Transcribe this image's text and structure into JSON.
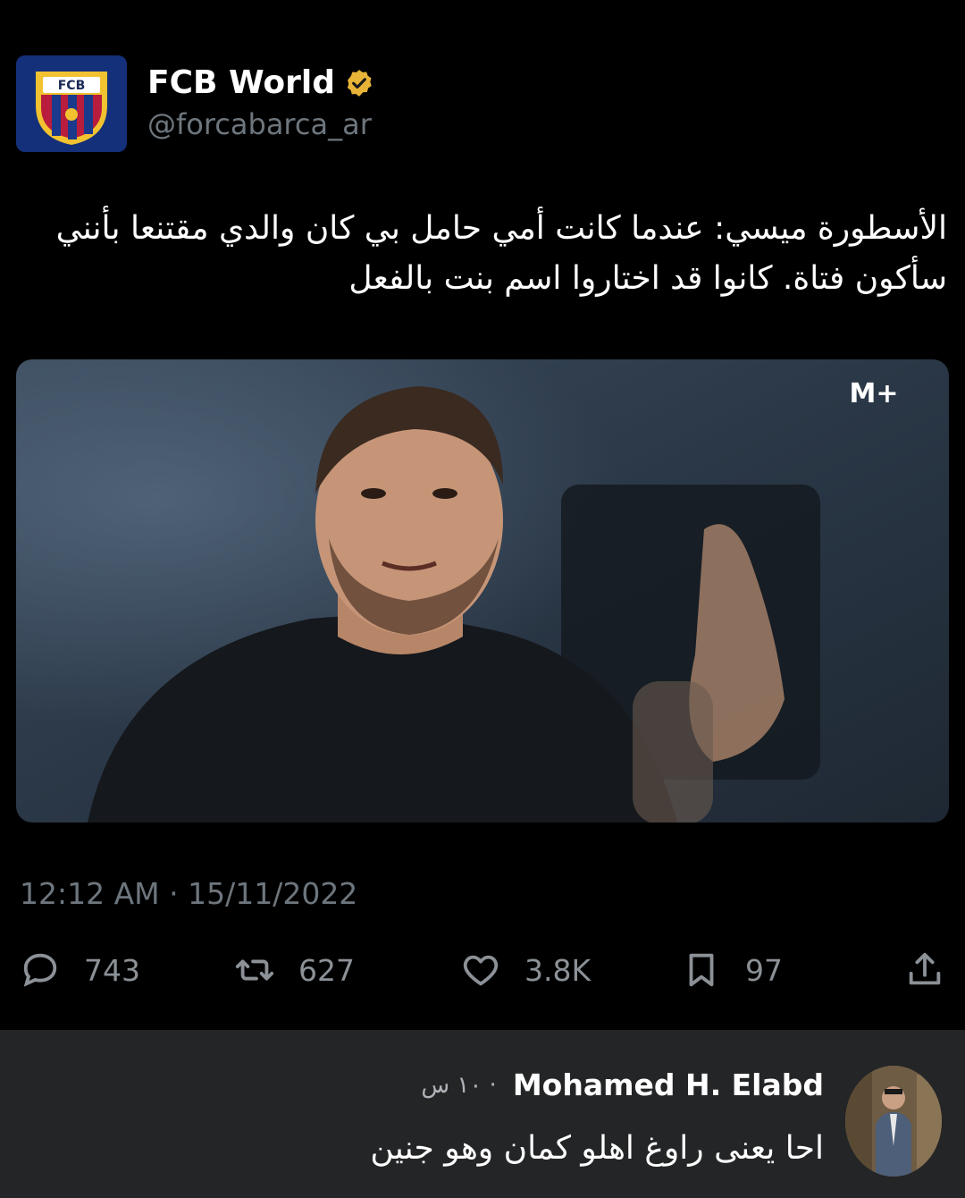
{
  "account": {
    "display_name": "FCB World",
    "handle": "@forcabarca_ar",
    "avatar_text": "FCB",
    "verified_icon": "verified-badge-icon"
  },
  "tweet": {
    "text": "الأسطورة ميسي: عندما كانت أمي حامل بي كان والدي مقتنعا بأنني سأكون فتاة. كانوا قد اختاروا اسم بنت بالفعل",
    "media_watermark": "M+",
    "timestamp": "12:12 AM · 15/11/2022"
  },
  "actions": {
    "replies": "743",
    "retweets": "627",
    "likes": "3.8K",
    "bookmarks": "97"
  },
  "comment": {
    "author": "Mohamed H. Elabd",
    "time": "· ١٠ س",
    "text": "احا يعنى راوغ اهلو كمان وهو جنين"
  },
  "colors": {
    "background": "#000000",
    "muted_text": "#6e767d",
    "verified_badge": "#e8b437",
    "comment_background": "#242526"
  }
}
